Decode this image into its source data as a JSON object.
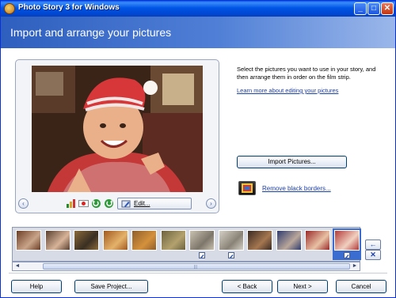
{
  "window": {
    "title": "Photo Story 3 for Windows",
    "controls": {
      "minimize": "_",
      "maximize": "□",
      "close": "✕"
    }
  },
  "header": {
    "title": "Import and arrange your pictures"
  },
  "preview": {
    "nav_prev": "‹",
    "nav_next": "›",
    "edit_label": "Edit..."
  },
  "right": {
    "instructions": "Select the pictures you want to use in your story, and then arrange them in order on the film strip.",
    "learn_more_link": "Learn more about editing your pictures",
    "import_button": "Import Pictures...",
    "remove_borders_link": "Remove black borders..."
  },
  "filmstrip": {
    "thumbnails": [
      {
        "colors": [
          "#6b3e25",
          "#c9a489"
        ],
        "edit_badge": false
      },
      {
        "colors": [
          "#5a4030",
          "#d7b399"
        ],
        "edit_badge": false
      },
      {
        "colors": [
          "#8a6a3a",
          "#3a2f22"
        ],
        "edit_badge": false
      },
      {
        "colors": [
          "#a2591f",
          "#e4b26b"
        ],
        "edit_badge": false
      },
      {
        "colors": [
          "#8f5f2b",
          "#d4913c"
        ],
        "edit_badge": false
      },
      {
        "colors": [
          "#6e6240",
          "#b3a26e"
        ],
        "edit_badge": false
      },
      {
        "colors": [
          "#c9c1b0",
          "#7d766a"
        ],
        "edit_badge": true
      },
      {
        "colors": [
          "#d4cfc5",
          "#898377"
        ],
        "edit_badge": true
      },
      {
        "colors": [
          "#3a2a22",
          "#a57750"
        ],
        "edit_badge": false
      },
      {
        "colors": [
          "#2f3c6e",
          "#b9a79a"
        ],
        "edit_badge": false
      },
      {
        "colors": [
          "#9a2a2a",
          "#e7c1a4"
        ],
        "edit_badge": false
      },
      {
        "colors": [
          "#b33a3a",
          "#f1d0c0"
        ],
        "edit_badge": true,
        "selected": true
      }
    ],
    "scroll_left": "◄",
    "scroll_right": "►",
    "grip": "|||",
    "move_up": "➔",
    "move_left": "←",
    "delete": "✕"
  },
  "footer": {
    "help": "Help",
    "save_project": "Save Project...",
    "back": "< Back",
    "next": "Next >",
    "cancel": "Cancel"
  },
  "colors": {
    "titlebar": "#0055e5",
    "header_left": "#2e5fbf",
    "link": "#1b3fae",
    "selection": "#3b6ccf"
  }
}
